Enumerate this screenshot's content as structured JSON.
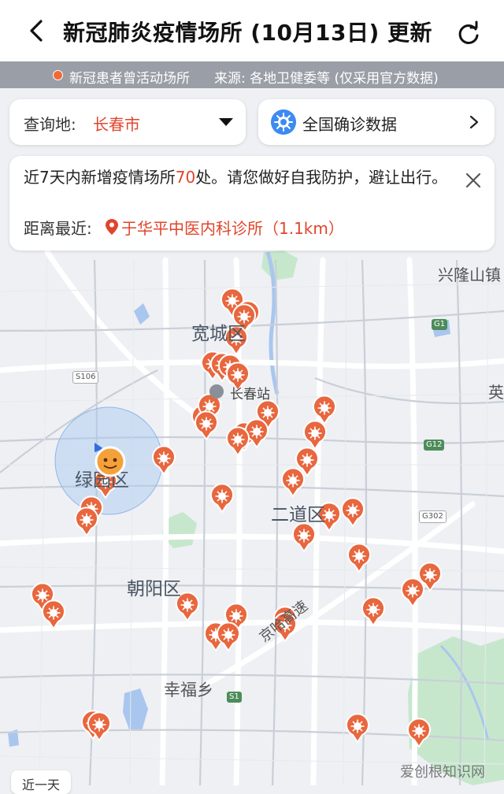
{
  "header": {
    "title": "新冠肺炎疫情场所 (10月13日) 更新"
  },
  "legend": {
    "label": "新冠患者曾活动场所",
    "source": "来源: 各地卫健委等 (仅采用官方数据)",
    "dot_color": "#f06a35"
  },
  "query": {
    "label": "查询地:",
    "city": "长春市"
  },
  "national": {
    "label": "全国确诊数据"
  },
  "notice": {
    "prefix": "近7天内新增疫情场所",
    "count": "70",
    "suffix": "处。请您做好自我防护，避让出行。",
    "nearest_label": "距离最近:",
    "nearest_place": "于华平中医内科诊所（1.1km）"
  },
  "map_labels": {
    "kuancheng": "宽城区",
    "changchun_station": "长春站",
    "lvyuan": "绿园区",
    "erdao": "二道区",
    "chaoyang": "朝阳区",
    "xingfu": "幸福乡",
    "xinglong": "兴隆山镇",
    "ying": "英",
    "expressway": "京哈高速",
    "road_s106": "S106",
    "road_g1": "G1",
    "road_g12": "G12",
    "road_g302": "G302",
    "road_s1": "S1"
  },
  "bottom_tab": {
    "label": "近一天"
  },
  "watermark": "爱创根知识网",
  "colors": {
    "accent": "#e0452b",
    "marker": "#e8673e",
    "water": "#a9c6ef",
    "park": "#bfe3c6"
  }
}
